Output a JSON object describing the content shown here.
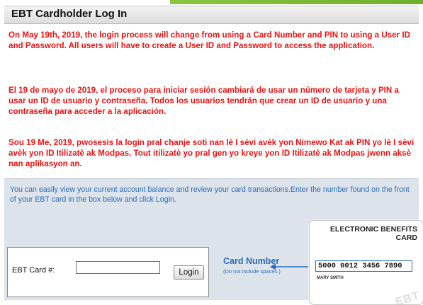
{
  "header": {
    "title": "EBT Cardholder Log In"
  },
  "notices": {
    "english": "On May 19th, 2019, the login process will change from using a Card Number and PIN to using a User ID and Password. All users will have to create a User ID and Password to access the application.",
    "spanish": "El 19 de mayo de 2019, el proceso para iniciar sesión cambiará de usar un número de tarjeta y PIN a usar un ID de usuario y contraseña. Todos los usuarios tendrán que crear un ID de usuario y una contraseña para acceder a la aplicación.",
    "creole": "Sou 19 Me, 2019, pwosesis la login pral chanje soti nan lè I sèvi avèk yon Nimewo Kat ak PIN yo lè I sèvi avèk yon ID Itilizatè ak Modpas. Tout itilizatè yo pral gen yo kreye yon ID Itilizatè ak Modpas jwenn aksè nan aplikasyon an."
  },
  "info": {
    "text": "You can easily view your current account balance and review your card transactions.Enter the number found on the front of your EBT card in the box below and click Login."
  },
  "login": {
    "label": "EBT Card #:",
    "value": "",
    "button": "Login"
  },
  "card_hint": {
    "label": "Card Number",
    "note": "(Do not include spaces.)"
  },
  "ebt_card": {
    "line1": "ELECTRONIC BENEFITS",
    "line2": "CARD",
    "number": "5000 0012 3456 7890",
    "name": "MARY SMITH",
    "watermark": "EBT"
  },
  "colors": {
    "notice_red": "#ee1111",
    "info_blue": "#2b6cb8",
    "panel_bg": "#dde3ea",
    "accent_green": "#8cc63f"
  }
}
